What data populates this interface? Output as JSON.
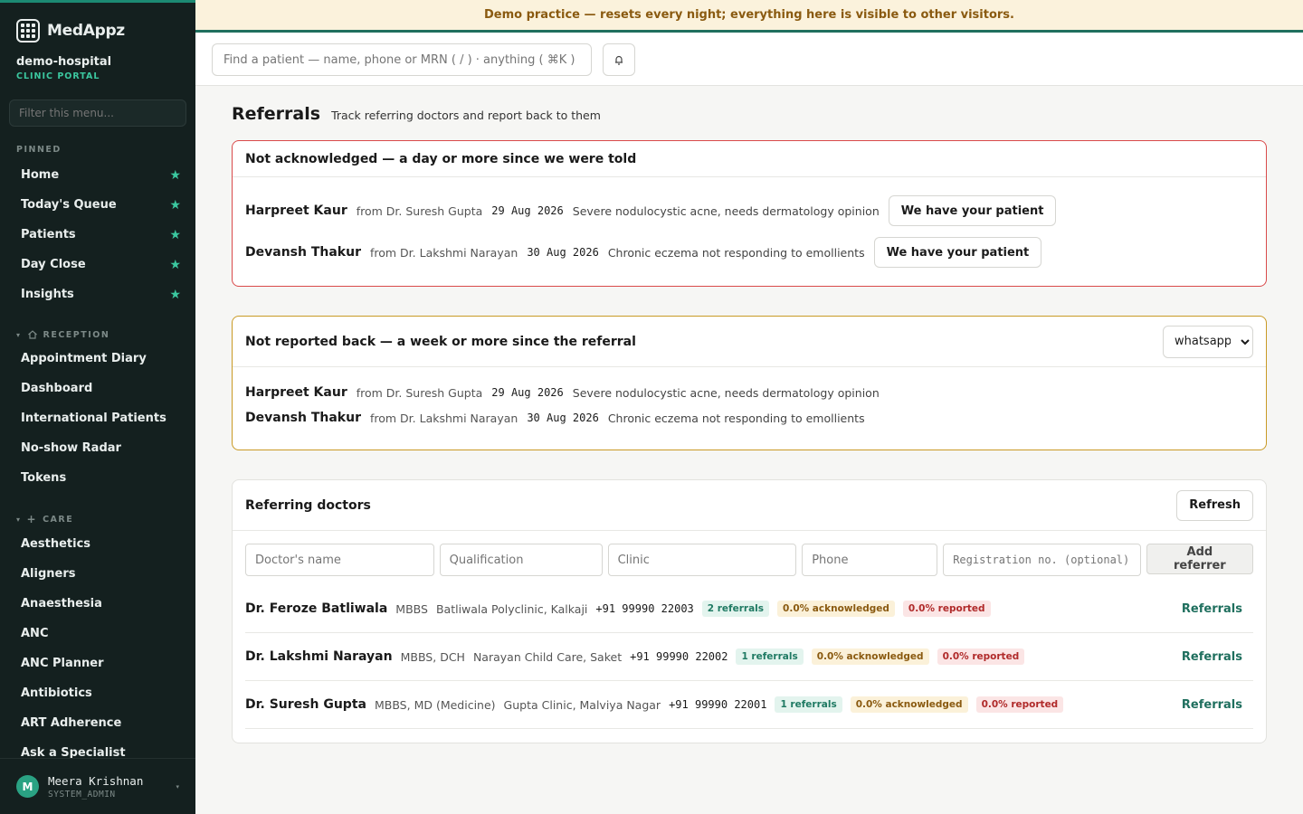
{
  "brand": {
    "name": "MedAppz"
  },
  "org": {
    "name": "demo-hospital",
    "subtitle": "CLINIC PORTAL"
  },
  "sidebar": {
    "filter_placeholder": "Filter this menu...",
    "pinned_label": "PINNED",
    "pinned": [
      {
        "label": "Home"
      },
      {
        "label": "Today's Queue"
      },
      {
        "label": "Patients"
      },
      {
        "label": "Day Close"
      },
      {
        "label": "Insights"
      }
    ],
    "reception_label": "RECEPTION",
    "reception": [
      {
        "label": "Appointment Diary"
      },
      {
        "label": "Dashboard"
      },
      {
        "label": "International Patients"
      },
      {
        "label": "No-show Radar"
      },
      {
        "label": "Tokens"
      }
    ],
    "care_label": "CARE",
    "care": [
      {
        "label": "Aesthetics"
      },
      {
        "label": "Aligners"
      },
      {
        "label": "Anaesthesia"
      },
      {
        "label": "ANC"
      },
      {
        "label": "ANC Planner"
      },
      {
        "label": "Antibiotics"
      },
      {
        "label": "ART Adherence"
      },
      {
        "label": "Ask a Specialist"
      }
    ]
  },
  "user": {
    "initial": "M",
    "name": "Meera Krishnan",
    "role": "SYSTEM_ADMIN"
  },
  "banner": {
    "text": "Demo practice — resets every night; everything here is visible to other visitors."
  },
  "search": {
    "placeholder": "Find a patient — name, phone or MRN ( / ) · anything ( ⌘K )"
  },
  "page": {
    "title": "Referrals",
    "subtitle": "Track referring doctors and report back to them"
  },
  "not_acknowledged": {
    "title": "Not acknowledged — a day or more since we were told",
    "button_label": "We have your patient",
    "rows": [
      {
        "name": "Harpreet Kaur",
        "from": "from Dr. Suresh Gupta",
        "date": "29 Aug 2026",
        "reason": "Severe nodulocystic acne, needs dermatology opinion"
      },
      {
        "name": "Devansh Thakur",
        "from": "from Dr. Lakshmi Narayan",
        "date": "30 Aug 2026",
        "reason": "Chronic eczema not responding to emollients"
      }
    ]
  },
  "not_reported": {
    "title": "Not reported back — a week or more since the referral",
    "channel": "whatsapp",
    "rows": [
      {
        "name": "Harpreet Kaur",
        "from": "from Dr. Suresh Gupta",
        "date": "29 Aug 2026",
        "reason": "Severe nodulocystic acne, needs dermatology opinion"
      },
      {
        "name": "Devansh Thakur",
        "from": "from Dr. Lakshmi Narayan",
        "date": "30 Aug 2026",
        "reason": "Chronic eczema not responding to emollients"
      }
    ]
  },
  "referring_doctors": {
    "title": "Referring doctors",
    "refresh_label": "Refresh",
    "form": {
      "name_placeholder": "Doctor's name",
      "qualification_placeholder": "Qualification",
      "clinic_placeholder": "Clinic",
      "phone_placeholder": "Phone",
      "registration_placeholder": "Registration no. (optional)",
      "add_label": "Add referrer"
    },
    "link_label": "Referrals",
    "doctors": [
      {
        "name": "Dr. Feroze Batliwala",
        "qualification": "MBBS",
        "clinic": "Batliwala Polyclinic, Kalkaji",
        "phone": "+91 99990 22003",
        "referrals": "2 referrals",
        "acknowledged": "0.0% acknowledged",
        "reported": "0.0% reported"
      },
      {
        "name": "Dr. Lakshmi Narayan",
        "qualification": "MBBS, DCH",
        "clinic": "Narayan Child Care, Saket",
        "phone": "+91 99990 22002",
        "referrals": "1 referrals",
        "acknowledged": "0.0% acknowledged",
        "reported": "0.0% reported"
      },
      {
        "name": "Dr. Suresh Gupta",
        "qualification": "MBBS, MD (Medicine)",
        "clinic": "Gupta Clinic, Malviya Nagar",
        "phone": "+91 99990 22001",
        "referrals": "1 referrals",
        "acknowledged": "0.0% acknowledged",
        "reported": "0.0% reported"
      }
    ]
  },
  "colors": {
    "accent": "#1f6f5e",
    "sidebar_bg": "#14201f",
    "star": "#3bc79f",
    "alert_red": "#d94a4a",
    "alert_amber": "#c99a25",
    "banner_bg": "#fbf2dc"
  }
}
